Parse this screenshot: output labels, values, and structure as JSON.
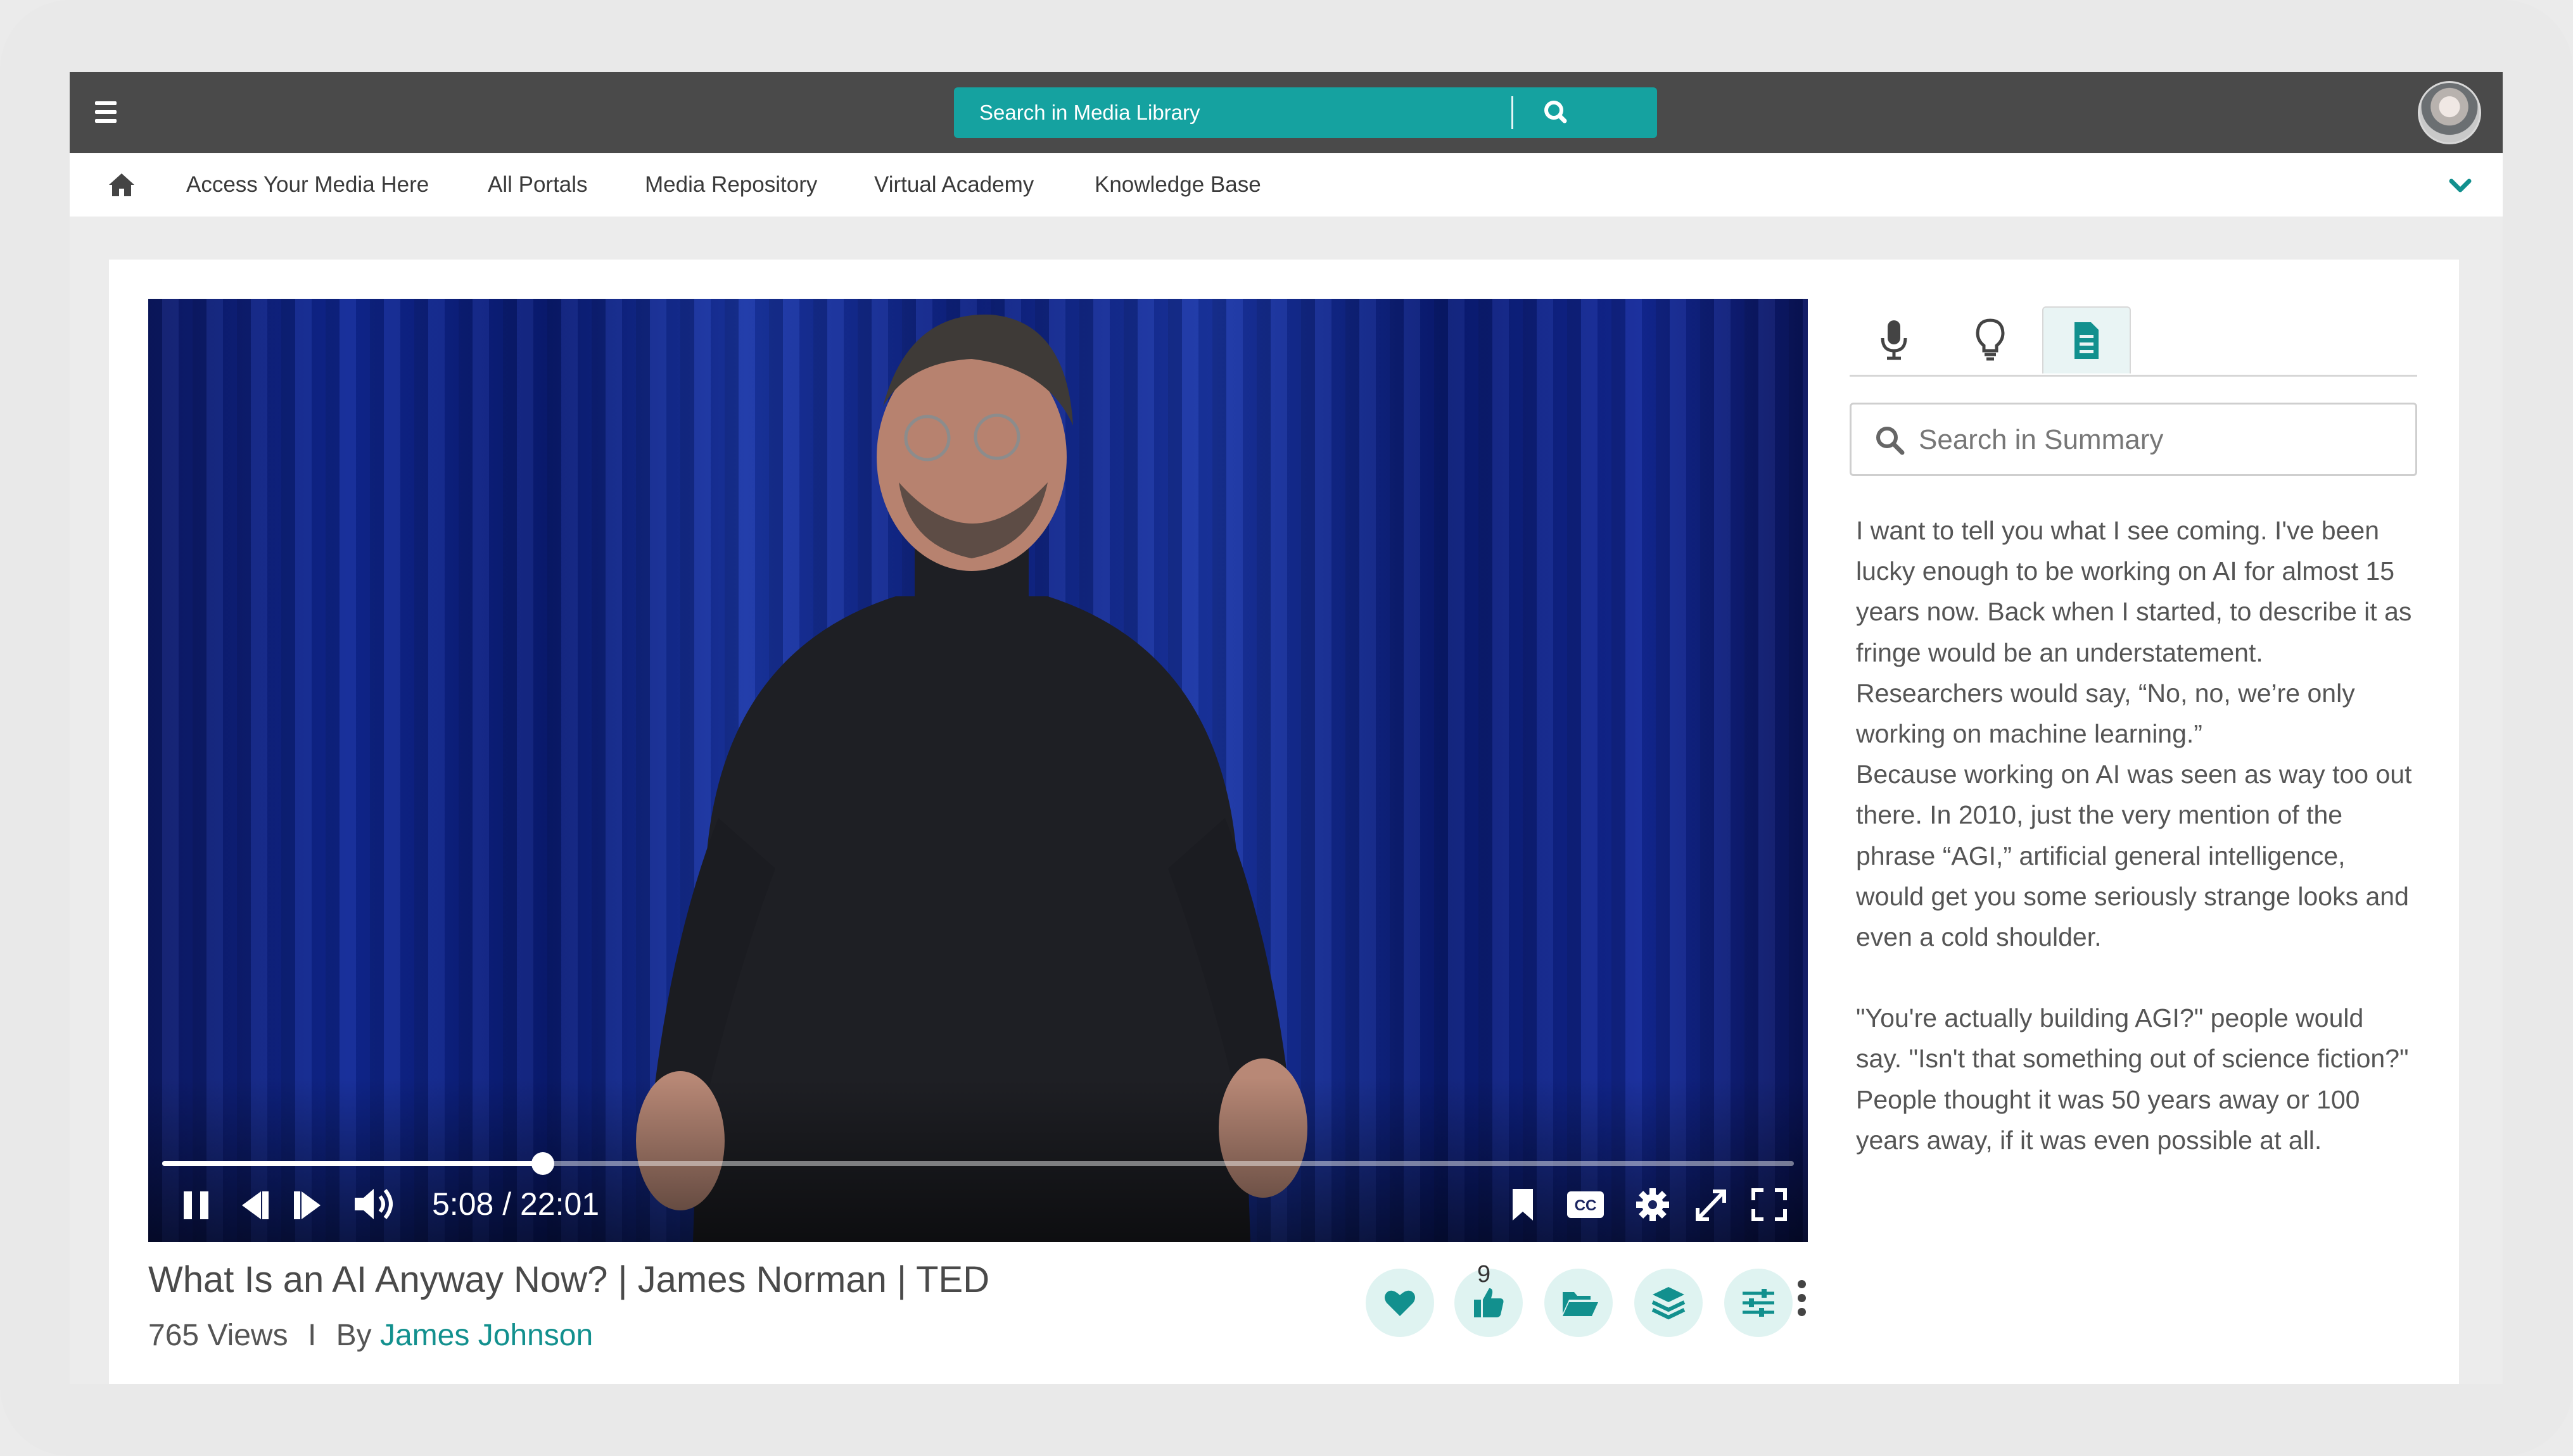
{
  "header": {
    "search_placeholder": "Search in Media Library",
    "icons": {
      "menu": "hamburger-icon",
      "search": "search-icon",
      "avatar": "user-avatar"
    }
  },
  "nav": {
    "home_icon": "home-icon",
    "items": [
      "Access Your Media Here",
      "All Portals",
      "Media Repository",
      "Virtual Academy",
      "Knowledge Base"
    ],
    "expand_icon": "chevron-down-icon"
  },
  "player": {
    "current_time": "5:08",
    "duration": "22:01",
    "time_display": "5:08 / 22:01",
    "progress_fraction": 0.2332,
    "state": "playing",
    "controls_left": [
      "pause-icon",
      "previous-icon",
      "next-icon",
      "volume-icon"
    ],
    "controls_right": [
      "bookmark-icon",
      "closed-captions-icon",
      "settings-icon",
      "expand-icon",
      "fullscreen-icon"
    ]
  },
  "video": {
    "title": "What Is an AI Anyway Now? | James Norman | TED",
    "views": "765 Views",
    "separator": "I",
    "by_label": "By",
    "author": "James Johnson",
    "like_count": "9",
    "actions": [
      "heart-icon",
      "thumbs-up-icon",
      "folder-icon",
      "layers-icon",
      "sliders-icon",
      "more-icon"
    ]
  },
  "sidepanel": {
    "tabs": [
      "microphone-icon",
      "lightbulb-icon",
      "document-icon"
    ],
    "active_tab": "document-icon",
    "search_placeholder": "Search in Summary",
    "paragraphs": [
      "I want to tell you what I see coming. I've been lucky enough to be working on AI for almost 15 years now. Back when I started, to describe it as fringe would be an understatement. Researchers would say, “No, no, we’re only working on machine learning.”",
      "Because working on AI was seen as way too out there. In 2010, just the very mention of the phrase “AGI,” artificial general intelligence, would get you some seriously strange looks and even a cold shoulder.",
      "\"You're actually building AGI?\" people would say. \"Isn't that something out of science fiction?\" People thought it was 50 years away or 100 years away, if it was even possible at all."
    ]
  },
  "colors": {
    "accent": "#15a2a0",
    "topbar": "#4a4a4a",
    "accent_light": "#dff3f1"
  }
}
